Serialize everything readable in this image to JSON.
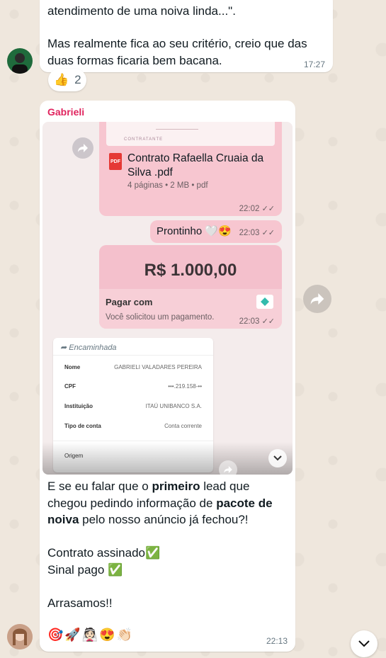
{
  "messages": {
    "top": {
      "line1": "atendimento de uma noiva linda...\".",
      "line2": "Mas realmente fica ao seu critério, creio que das duas formas ficaria bem bacana.",
      "time": "17:27",
      "reaction_emoji": "👍",
      "reaction_count": "2"
    },
    "gabrieli": {
      "sender": "Gabrieli",
      "sender_color": "#e0245e",
      "media": {
        "contract_header": "CONTRATANTE",
        "doc_title": "Contrato Rafaella Cruaia da Silva .pdf",
        "doc_meta": "4 páginas • 2 MB • pdf",
        "doc_time": "22:02",
        "reply_text": "Prontinho 🤍😍",
        "reply_time": "22:03",
        "amount": "R$ 1.000,00",
        "pay_label": "Pagar com",
        "pay_sub": "Você solicitou um pagamento.",
        "pay_time": "22:03",
        "forwarded": "Encaminhada",
        "receipt": [
          {
            "key": "Nome",
            "value": "GABRIELI VALADARES PEREIRA"
          },
          {
            "key": "CPF",
            "value": "•••.219.158-••"
          },
          {
            "key": "Instituição",
            "value": "ITAÚ UNIBANCO S.A."
          },
          {
            "key": "Tipo de conta",
            "value": "Conta corrente"
          },
          {
            "key": "Origem",
            "value": ""
          }
        ]
      },
      "text_p1_a": "E se eu falar que o ",
      "text_p1_b": "primeiro",
      "text_p1_c": " lead que chegou pedindo informação de ",
      "text_p1_d": "pacote de noiva",
      "text_p1_e": " pelo nosso anúncio já fechou?!",
      "text_p2": "Contrato assinado✅",
      "text_p3": "Sinal pago ✅",
      "text_p4": "Arrasamos!!",
      "reactions": "🎯🚀👰🏻😍👏🏻",
      "time": "22:13"
    }
  },
  "colors": {
    "pink_bubble": "#f7c6d0",
    "accent": "#e0245e"
  }
}
